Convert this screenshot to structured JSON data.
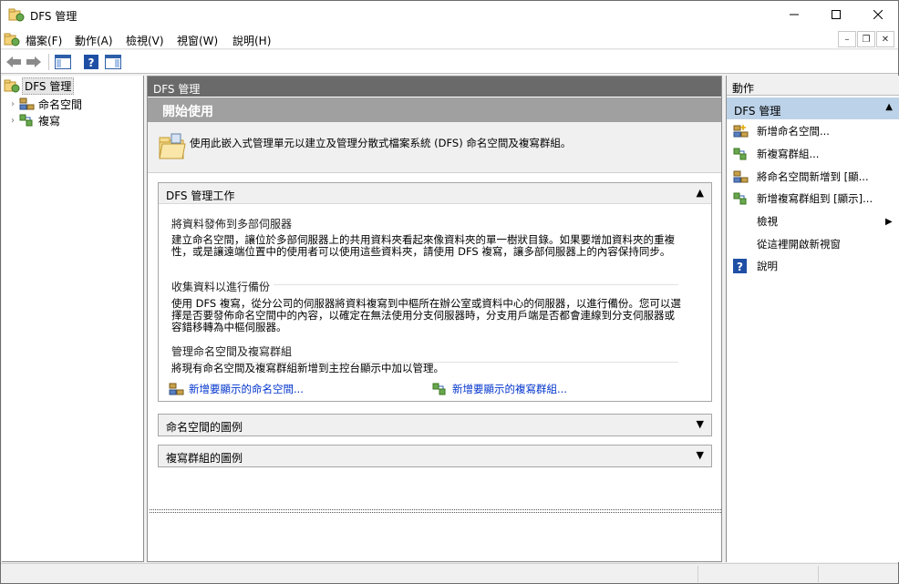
{
  "window": {
    "title": "DFS 管理",
    "controls": [
      "minimize",
      "maximize",
      "close"
    ]
  },
  "menubar": {
    "items": [
      "檔案(F)",
      "動作(A)",
      "檢視(V)",
      "視窗(W)",
      "說明(H)"
    ]
  },
  "toolbar": {
    "buttons": [
      "back-icon",
      "forward-icon",
      "show-hide-console-tree-icon",
      "help-icon",
      "show-hide-action-pane-icon"
    ]
  },
  "tree": {
    "root": "DFS 管理",
    "children": [
      "命名空間",
      "複寫"
    ]
  },
  "center": {
    "header": "DFS 管理",
    "intro_title": "開始使用",
    "intro_text": "使用此嵌入式管理單元以建立及管理分散式檔案系統 (DFS) 命名空間及複寫群組。",
    "tasks_section": {
      "title": "DFS 管理工作",
      "items": [
        {
          "title": "將資料發佈到多部伺服器",
          "body": "建立命名空間，讓位於多部伺服器上的共用資料夾看起來像資料夾的單一樹狀目錄。如果要增加資料夾的重複性，或是讓遠端位置中的使用者可以使用這些資料夾，請使用 DFS 複寫，讓多部伺服器上的內容保持同步。"
        },
        {
          "title": "收集資料以進行備份",
          "body": "使用 DFS 複寫，從分公司的伺服器將資料複寫到中樞所在辦公室或資料中心的伺服器，以進行備份。您可以選擇是否要發佈命名空間中的內容，以確定在無法使用分支伺服器時，分支用戶端是否都會連線到分支伺服器或容錯移轉為中樞伺服器。"
        },
        {
          "title": "管理命名空間及複寫群組",
          "body": "將現有命名空間及複寫群組新增到主控台顯示中加以管理。"
        }
      ],
      "links": [
        "新增要顯示的命名空間...",
        "新增要顯示的複寫群組..."
      ]
    },
    "collapsed_sections": [
      "命名空間的圖例",
      "複寫群組的圖例"
    ]
  },
  "actions": {
    "header": "動作",
    "group": "DFS 管理",
    "items": [
      {
        "label": "新增命名空間...",
        "icon": "new-namespace-icon"
      },
      {
        "label": "新複寫群組...",
        "icon": "new-replication-group-icon"
      },
      {
        "label": "將命名空間新增到 [顯...",
        "icon": "add-namespace-to-display-icon"
      },
      {
        "label": "新增複寫群組到 [顯示]...",
        "icon": "add-replication-group-to-display-icon"
      },
      {
        "label": "檢視",
        "icon": ""
      },
      {
        "label": "從這裡開啟新視窗",
        "icon": ""
      },
      {
        "label": "說明",
        "icon": "help-icon"
      }
    ]
  }
}
